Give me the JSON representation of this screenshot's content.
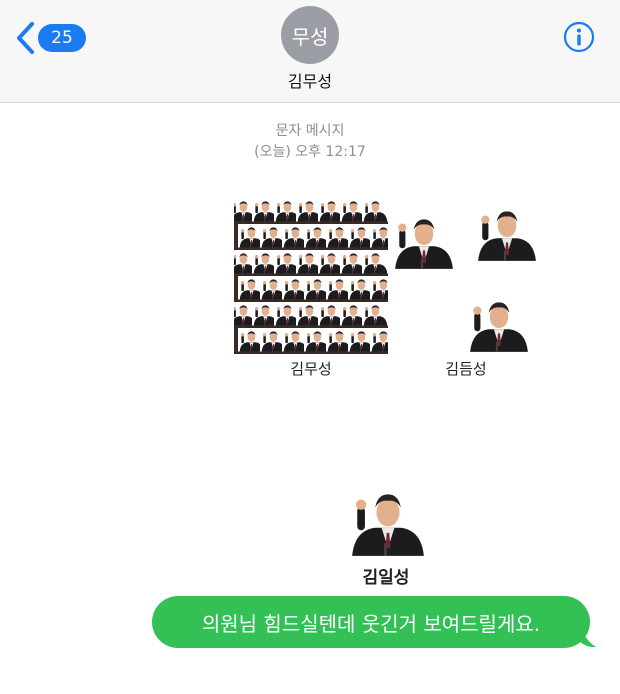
{
  "nav": {
    "unread_count": "25",
    "avatar_text": "무성",
    "contact_name": "김무성"
  },
  "conversation": {
    "service_label": "문자 메시지",
    "timestamp": "(오늘) 오후 12:17"
  },
  "meme": {
    "caption_left": "김무성",
    "caption_right": "김듬성",
    "caption_bottom": "김일성"
  },
  "message": {
    "text": "의원님 힘드실텐데 웃긴거 보여드릴게요.",
    "bubble_color": "#33c155"
  },
  "colors": {
    "accent": "#1a7bf2"
  }
}
